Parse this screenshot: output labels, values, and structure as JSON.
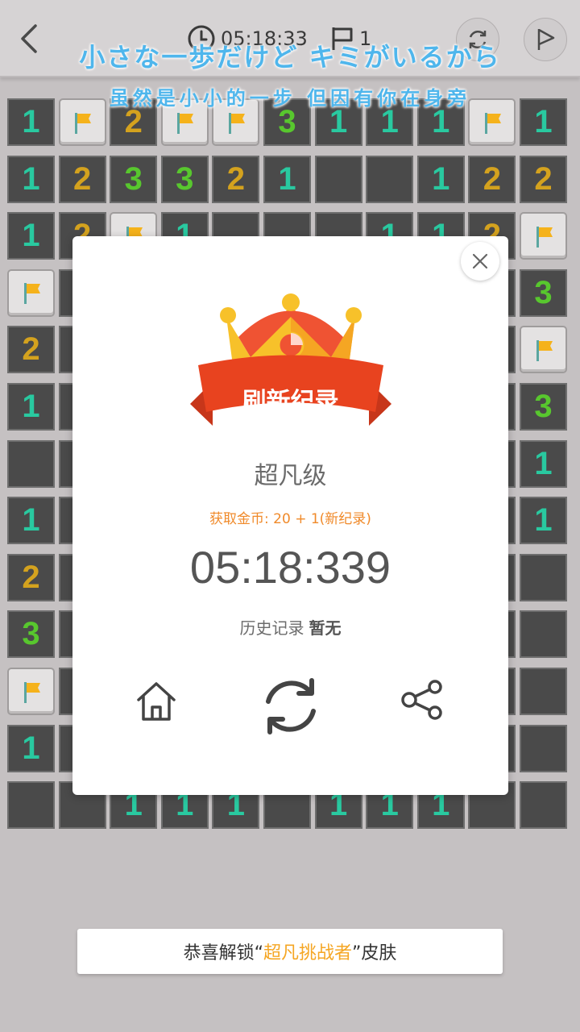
{
  "header": {
    "timer": "05:18:33",
    "flag_count": "1"
  },
  "lyrics": {
    "line1": "小さな一歩だけど キミがいるから",
    "line2": "虽然是小小的一步 但因有你在身旁"
  },
  "board": {
    "rows": [
      [
        "1",
        "F",
        "2",
        "F",
        "F",
        "3",
        "1",
        "1",
        "1",
        "F",
        "1"
      ],
      [
        "1",
        "2",
        "3",
        "3",
        "2",
        "1",
        "",
        "",
        "1",
        "2",
        "2"
      ],
      [
        "1",
        "2",
        "F",
        "1",
        "",
        "",
        "",
        "1",
        "1",
        "2",
        "F"
      ],
      [
        "F",
        "",
        "",
        "",
        "",
        "",
        "",
        "",
        "",
        "",
        "3"
      ],
      [
        "2",
        "",
        "",
        "",
        "",
        "",
        "",
        "",
        "",
        "",
        "F"
      ],
      [
        "1",
        "",
        "",
        "",
        "",
        "",
        "",
        "",
        "",
        "",
        "3"
      ],
      [
        "",
        "",
        "",
        "",
        "",
        "",
        "",
        "",
        "",
        "",
        "1"
      ],
      [
        "1",
        "",
        "",
        "",
        "",
        "",
        "",
        "",
        "",
        "",
        "1"
      ],
      [
        "2",
        "",
        "",
        "",
        "",
        "",
        "",
        "",
        "",
        "",
        ""
      ],
      [
        "3",
        "",
        "",
        "",
        "",
        "",
        "",
        "",
        "",
        "",
        ""
      ],
      [
        "F",
        "",
        "",
        "",
        "",
        "",
        "",
        "",
        "",
        "",
        ""
      ],
      [
        "1",
        "",
        "",
        "",
        "",
        "",
        "",
        "",
        "",
        "",
        ""
      ],
      [
        "",
        "",
        "1",
        "1",
        "1",
        "",
        "1",
        "1",
        "1",
        "",
        ""
      ]
    ]
  },
  "dialog": {
    "banner": "刷新纪录",
    "level": "超凡级",
    "coins": "获取金币: 20 + 1(新纪录)",
    "time": "05:18:339",
    "history_label": "历史记录",
    "history_value": "暂无"
  },
  "toast": {
    "prefix": "恭喜解锁“",
    "highlight": "超凡挑战者",
    "suffix": "”皮肤"
  },
  "colors": {
    "accent_orange": "#f5a623",
    "ribbon_red": "#e8431f",
    "number_1": "#29c9a0",
    "number_2": "#d4a21e",
    "number_3": "#58c72e"
  },
  "icons": [
    "back-arrow-icon",
    "clock-icon",
    "flag-icon",
    "restart-icon",
    "flag-mode-icon",
    "close-icon",
    "crown-icon",
    "home-icon",
    "refresh-icon",
    "share-icon"
  ]
}
